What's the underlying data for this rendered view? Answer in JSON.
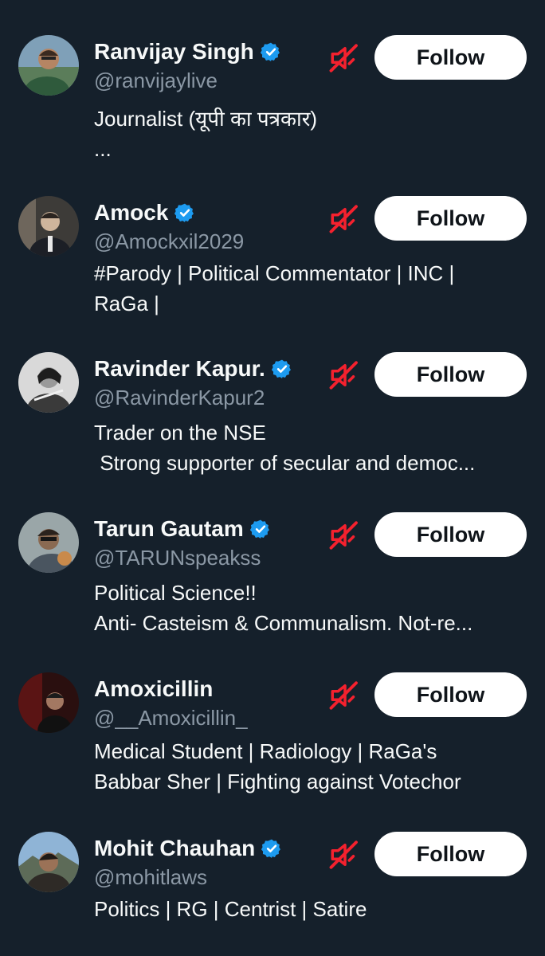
{
  "colors": {
    "background": "#15202b",
    "name": "#f7f9f9",
    "handle": "#8b98a5",
    "verified": "#1d9bf0",
    "muted_icon": "#f4212e",
    "follow_bg": "#ffffff",
    "follow_text": "#0f1419"
  },
  "icons": {
    "verified": "verified-badge-icon",
    "mute": "muted-speaker-icon"
  },
  "accounts": [
    {
      "name": "Ranvijay Singh",
      "handle": "@ranvijaylive",
      "verified": true,
      "bio": [
        "Journalist (यूपी का पत्रकार)",
        "..."
      ],
      "follow_label": "Follow"
    },
    {
      "name": "Amock",
      "handle": "@Amockxil2029",
      "verified": true,
      "bio": [
        "#Parody | Political Commentator | INC |",
        "RaGa |"
      ],
      "follow_label": "Follow"
    },
    {
      "name": "Ravinder Kapur.",
      "handle": "@RavinderKapur2",
      "verified": true,
      "bio": [
        "Trader on the NSE",
        " Strong supporter of secular and democ..."
      ],
      "follow_label": "Follow"
    },
    {
      "name": "Tarun Gautam",
      "handle": "@TARUNspeakss",
      "verified": true,
      "bio": [
        "Political Science!!",
        "Anti- Casteism & Communalism. Not-re..."
      ],
      "follow_label": "Follow"
    },
    {
      "name": "Amoxicillin",
      "handle": "@__Amoxicillin_",
      "verified": false,
      "bio": [
        "Medical Student | Radiology | RaGa's",
        "Babbar Sher | Fighting against Votechor"
      ],
      "follow_label": "Follow"
    },
    {
      "name": "Mohit Chauhan",
      "handle": "@mohitlaws",
      "verified": true,
      "bio": [
        "Politics | RG | Centrist | Satire"
      ],
      "follow_label": "Follow"
    }
  ]
}
